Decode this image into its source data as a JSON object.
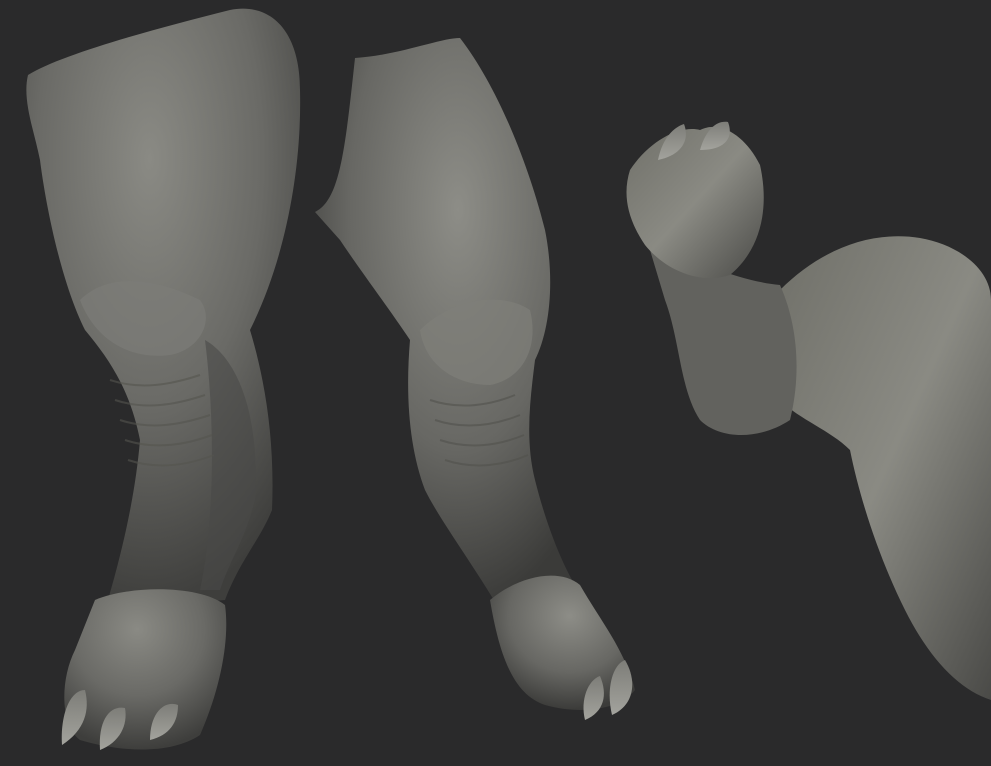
{
  "scene": {
    "background_color": "#2a2a2b",
    "material_color": "#6e6e6a",
    "views": [
      {
        "name": "leg-front-view"
      },
      {
        "name": "leg-side-view"
      },
      {
        "name": "foot-and-thigh-closeup-view"
      }
    ]
  }
}
